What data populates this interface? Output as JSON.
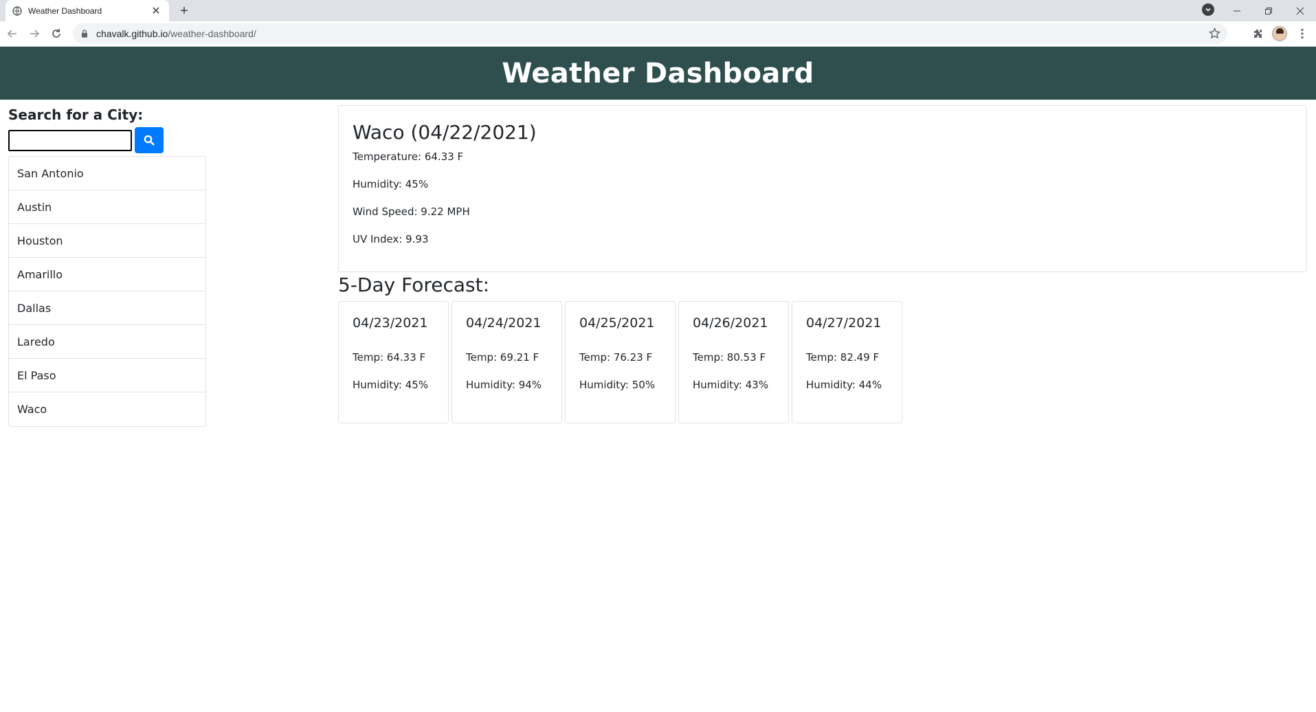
{
  "browser": {
    "tab_title": "Weather Dashboard",
    "new_tab_symbol": "+",
    "url_host": "chavalk.github.io",
    "url_path": "/weather-dashboard/"
  },
  "header": {
    "title": "Weather Dashboard"
  },
  "search": {
    "label": "Search for a City:",
    "value": "",
    "placeholder": ""
  },
  "cities": [
    "San Antonio",
    "Austin",
    "Houston",
    "Amarillo",
    "Dallas",
    "Laredo",
    "El Paso",
    "Waco"
  ],
  "current": {
    "heading": "Waco (04/22/2021)",
    "temperature": "Temperature: 64.33 F",
    "humidity": "Humidity: 45%",
    "wind": "Wind Speed: 9.22 MPH",
    "uv": "UV Index: 9.93"
  },
  "forecast": {
    "title": "5-Day Forecast:",
    "days": [
      {
        "date": "04/23/2021",
        "temp": "Temp: 64.33 F",
        "humidity": "Humidity: 45%"
      },
      {
        "date": "04/24/2021",
        "temp": "Temp: 69.21 F",
        "humidity": "Humidity: 94%"
      },
      {
        "date": "04/25/2021",
        "temp": "Temp: 76.23 F",
        "humidity": "Humidity: 50%"
      },
      {
        "date": "04/26/2021",
        "temp": "Temp: 80.53 F",
        "humidity": "Humidity: 43%"
      },
      {
        "date": "04/27/2021",
        "temp": "Temp: 82.49 F",
        "humidity": "Humidity: 44%"
      }
    ]
  },
  "colors": {
    "header_bg": "#2f4f4f",
    "search_button": "#007bff"
  }
}
